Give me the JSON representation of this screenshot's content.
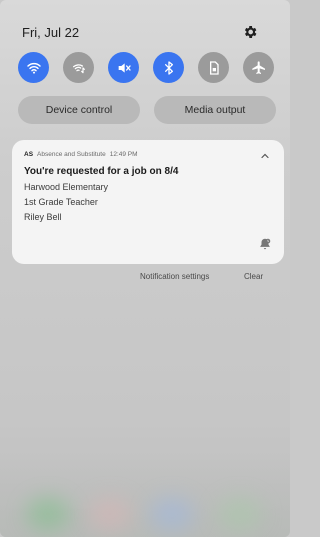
{
  "status_bar": {
    "date": "Fri, Jul 22",
    "settings_icon": "gear-icon"
  },
  "quick_toggles": [
    {
      "name": "wifi",
      "icon": "wifi-icon",
      "state": "on"
    },
    {
      "name": "mobile-data",
      "icon": "mobile-data-icon",
      "state": "off"
    },
    {
      "name": "sound",
      "icon": "mute-icon",
      "state": "on"
    },
    {
      "name": "bluetooth",
      "icon": "bluetooth-icon",
      "state": "on"
    },
    {
      "name": "sim",
      "icon": "sim-card-icon",
      "state": "off"
    },
    {
      "name": "airplane",
      "icon": "airplane-icon",
      "state": "off"
    }
  ],
  "quick_pills": {
    "device_control": "Device control",
    "media_output": "Media output"
  },
  "notification": {
    "app_abbr": "AS",
    "app_name": "Absence and Substitute",
    "time": "12:49 PM",
    "title": "You're requested for a job on 8/4",
    "line1": "Harwood Elementary",
    "line2": "1st Grade Teacher",
    "line3": "Riley Bell"
  },
  "footer": {
    "settings": "Notification settings",
    "clear": "Clear"
  },
  "colors": {
    "toggle_on": "#3a75f0",
    "toggle_off": "#9b9b9b",
    "card_bg": "#f4f4f4"
  }
}
